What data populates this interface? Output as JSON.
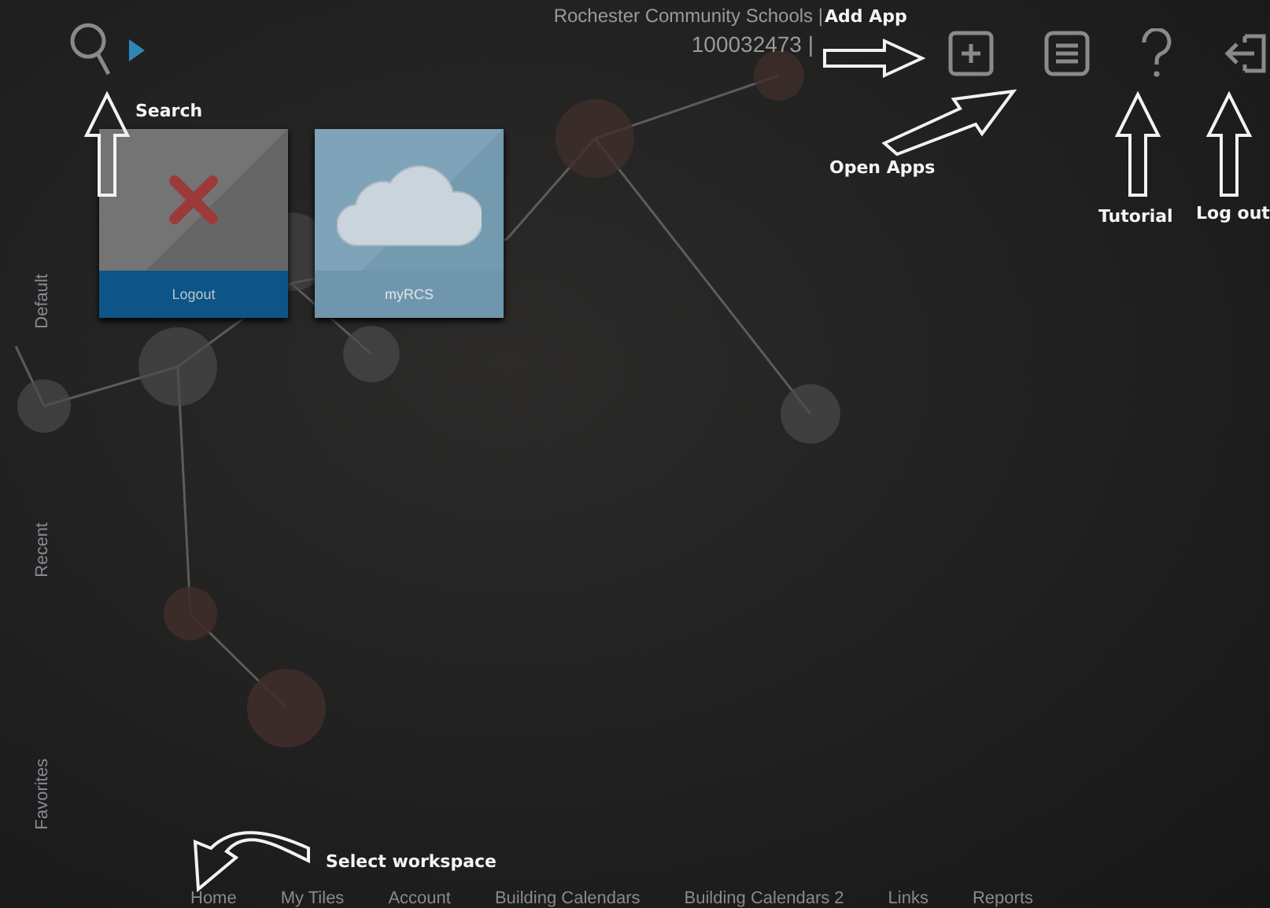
{
  "header": {
    "title": "Rochester Community Schools |",
    "subtitle": "100032473 |"
  },
  "side_tabs": [
    {
      "label": "Default"
    },
    {
      "label": "Recent"
    },
    {
      "label": "Favorites"
    }
  ],
  "tiles": [
    {
      "label": "Logout",
      "kind": "logout"
    },
    {
      "label": "myRCS",
      "kind": "cloud"
    }
  ],
  "workspaces": [
    "Home",
    "My Tiles",
    "Account",
    "Building Calendars",
    "Building Calendars 2",
    "Links",
    "Reports"
  ],
  "annotations": [
    {
      "text": "Search",
      "kind": "up"
    },
    {
      "text": "Add App",
      "kind": "right"
    },
    {
      "text": "Open Apps",
      "kind": "diagonal"
    },
    {
      "text": "Tutorial",
      "kind": "up"
    },
    {
      "text": "Log out",
      "kind": "up"
    },
    {
      "text": "Select workspace",
      "kind": "curve"
    }
  ]
}
